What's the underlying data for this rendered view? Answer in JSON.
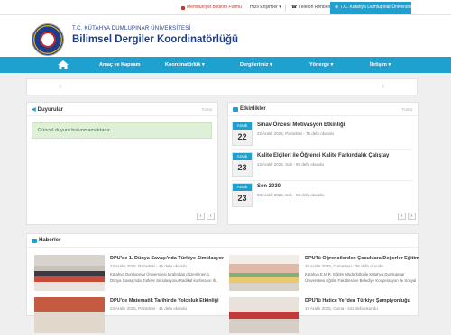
{
  "topbar": {
    "survey": "Memnuniyet Bildirim Formu",
    "quick_access": "Hızlı Erişimler ▾",
    "phone_book": "Telefon Rehberi",
    "university": "T.C. Kütahya Dumlupınar Üniversitesi"
  },
  "header": {
    "university_name": "T.C. KÜTAHYA DUMLUPINAR ÜNİVERSİTESİ",
    "site_title": "Bilimsel Dergiler Koordinatörlüğü"
  },
  "nav": {
    "items": [
      "Amaç ve Kapsam",
      "Koordinatörlük ▾",
      "Dergilerimiz ▾",
      "Yönerge ▾",
      "İletişim ▾"
    ]
  },
  "announcements": {
    "title": "Duyurular",
    "all_link": "Tümü",
    "empty_text": "Güncel duyuru bulunmamaktadır."
  },
  "events": {
    "title": "Etkinlikler",
    "all_link": "Tümü",
    "items": [
      {
        "month": "Aralık",
        "day": "22",
        "title": "Sınav Öncesi Motivasyon Etkinliği",
        "meta": "22 Aralık 2025, Pazartesi - 76 defa okundu"
      },
      {
        "month": "Aralık",
        "day": "23",
        "title": "Kalite Elçileri ile Öğrenci Kalite Farkındalık Çalıştay",
        "meta": "23 Aralık 2025, Salı - 89 defa okundu"
      },
      {
        "month": "Aralık",
        "day": "23",
        "title": "Sen 2030",
        "meta": "23 Aralık 2025, Salı - 98 defa okundu"
      }
    ]
  },
  "pager": {
    "prev": "‹",
    "next": "›"
  },
  "news": {
    "title": "Haberler",
    "items": [
      {
        "title": "DPÜ'de 1. Dünya Savaşı'nda Türkiye Simülasyonu...",
        "meta": "22 Aralık 2025, Pazartesi - 45 defa okundu",
        "text": "Kütahya Dumlupınar Üniversitesi tarafından düzenlenen 1. Dünya Savaşı'nda Türkiye Simülasyonu Radikal konferansı Ihl. Kabinesi Salo..."
      },
      {
        "title": "DPÜ'lü Öğrencilerden Çocuklara Değerler Eğitimi",
        "meta": "20 Aralık 2025, Cumartesi - 36 defa okundu",
        "text": "Kütahya E.M.R. Eğitim Müdürlüğü ile Kütahya Dumlupınar Üniversitesi Eğitim Fakültesi ve Belediye Kooperasyon ile Sosyal hizmetler arka..."
      },
      {
        "title": "DPÜ'de Matematik Tarihinde Yolculuk Etkinliği",
        "meta": "22 Aralık 2025, Pazartesi - 41 defa okundu",
        "text": ""
      },
      {
        "title": "DPÜ'lü Hatice Yel'den Türkiye Şampiyonluğu",
        "meta": "19 Aralık 2025, Cuma - 442 defa okundu",
        "text": ""
      }
    ]
  },
  "colors": {
    "accent": "#1fa1d0",
    "brand_blue": "#1e3c8c"
  }
}
